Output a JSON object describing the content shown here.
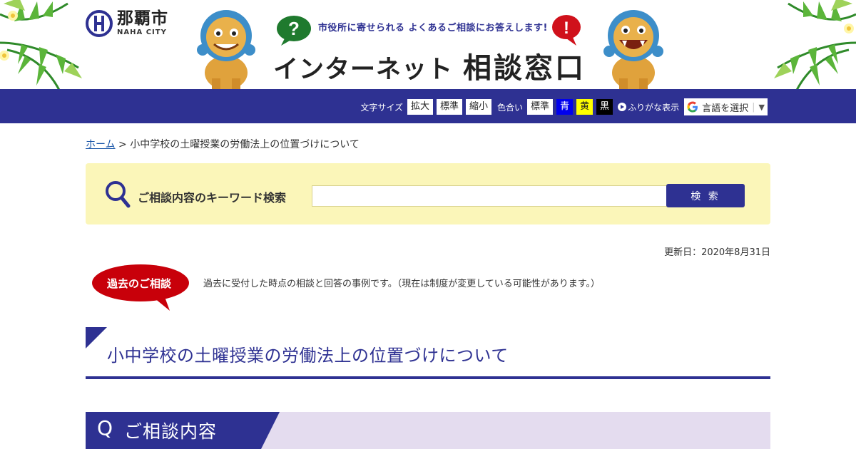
{
  "header": {
    "logo_name": "那覇市",
    "logo_sub": "NAHA CITY",
    "tagline": "市役所に寄せられる よくあるご相談にお答えします!",
    "title_part1": "インターネット",
    "title_part2": "相談窓口",
    "question_mark": "?",
    "exclaim_mark": "!"
  },
  "toolbar": {
    "font_size_label": "文字サイズ",
    "enlarge": "拡大",
    "standard": "標準",
    "shrink": "縮小",
    "color_label": "色合い",
    "color_standard": "標準",
    "color_blue": "青",
    "color_yellow": "黄",
    "color_black": "黒",
    "ruby_label": "ふりがな表示",
    "lang_label": "言語を選択",
    "lang_arrow": "▼"
  },
  "breadcrumb": {
    "home": "ホーム",
    "separator": " > ",
    "current": "小中学校の土曜授業の労働法上の位置づけについて"
  },
  "search": {
    "label": "ご相談内容のキーワード検索",
    "placeholder": "",
    "button": "検 索"
  },
  "updated": "更新日：2020年8月31日",
  "past_badge": "過去のご相談",
  "notice": "過去に受付した時点の相談と回答の事例です。（現在は制度が変更している可能性があります。）",
  "page_title": "小中学校の土曜授業の労働法上の位置づけについて",
  "section": {
    "q_letter": "Q",
    "q_title": "ご相談内容"
  },
  "colors": {
    "brand_navy": "#2e3192",
    "search_bg": "#fbf6b9",
    "badge_red": "#c8000a",
    "q_bar_light": "#e4dcef"
  },
  "icons": [
    "palm-left-icon",
    "palm-right-icon",
    "city-emblem-icon",
    "shisa-left-icon",
    "shisa-right-icon",
    "question-bubble-icon",
    "exclamation-bubble-icon",
    "play-icon",
    "google-g-icon",
    "search-icon",
    "speech-bubble-icon"
  ]
}
